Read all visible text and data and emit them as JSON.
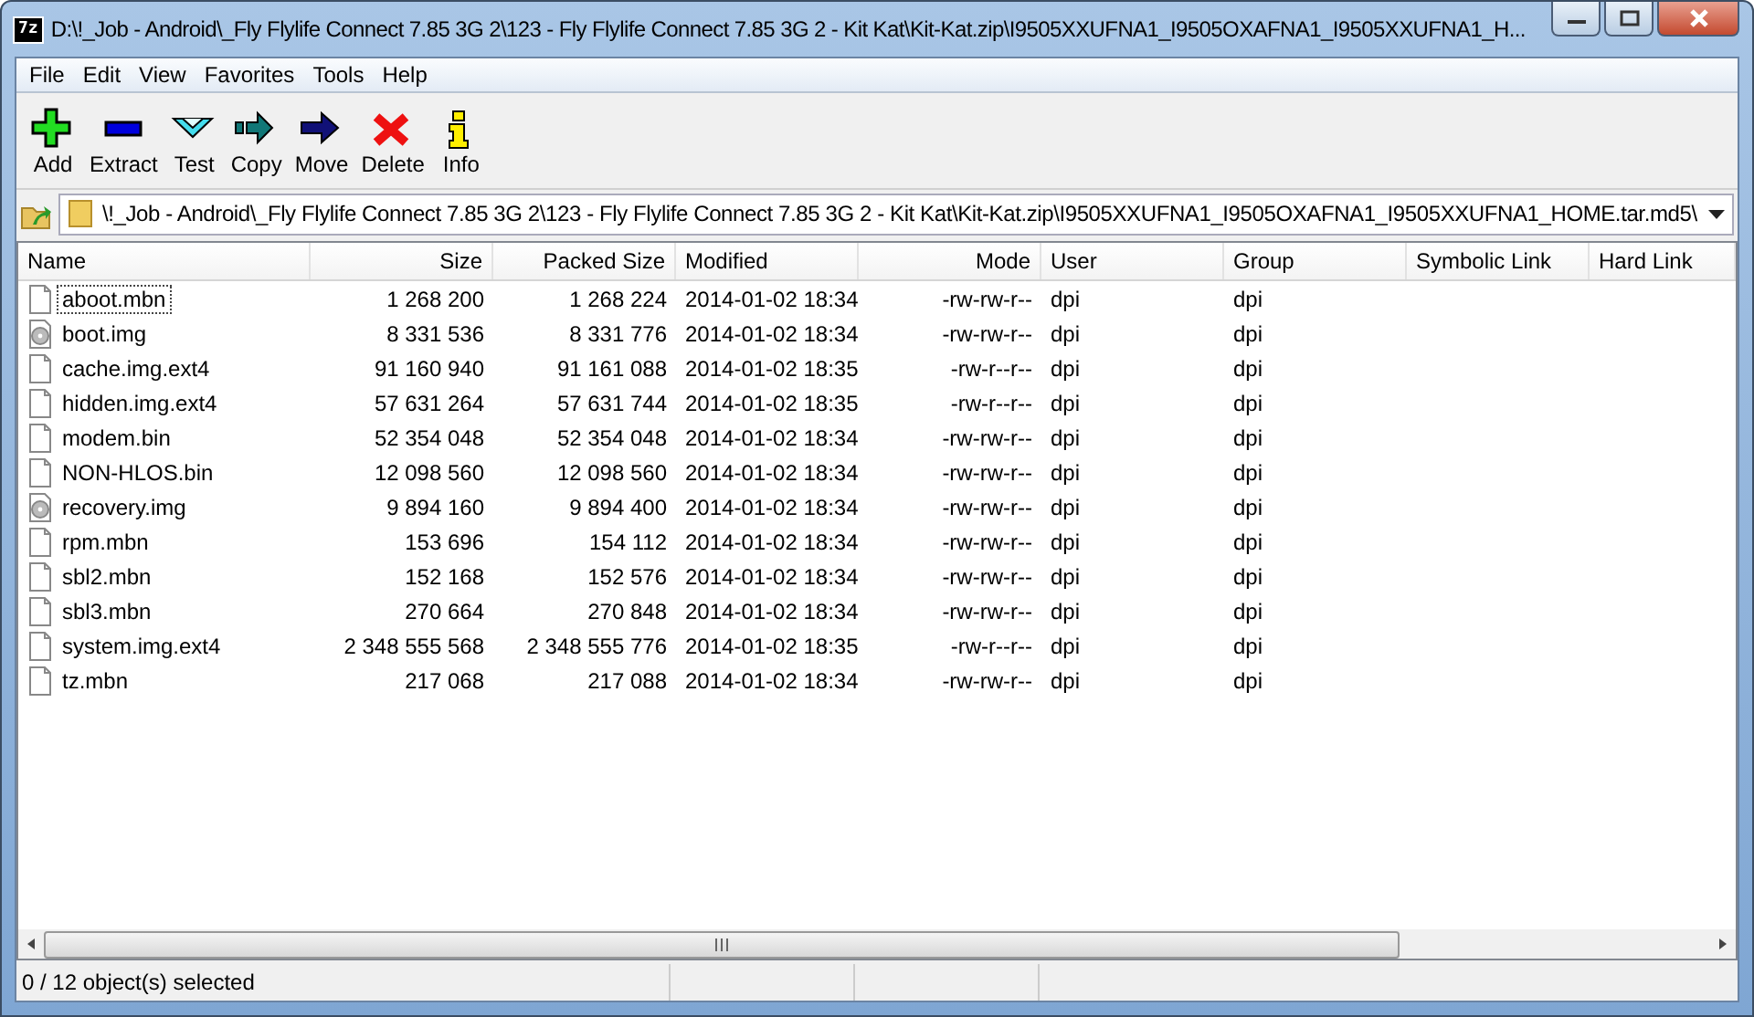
{
  "window": {
    "title": "D:\\!_Job - Android\\_Fly Flylife Connect 7.85 3G 2\\123 - Fly Flylife Connect 7.85 3G 2 - Kit Kat\\Kit-Kat.zip\\I9505XXUFNA1_I9505OXAFNA1_I9505XXUFNA1_H...",
    "app_icon": "7z"
  },
  "menu": [
    "File",
    "Edit",
    "View",
    "Favorites",
    "Tools",
    "Help"
  ],
  "toolbar": [
    {
      "label": "Add",
      "kind": "add"
    },
    {
      "label": "Extract",
      "kind": "extract"
    },
    {
      "label": "Test",
      "kind": "test"
    },
    {
      "label": "Copy",
      "kind": "copy"
    },
    {
      "label": "Move",
      "kind": "move"
    },
    {
      "label": "Delete",
      "kind": "delete"
    },
    {
      "label": "Info",
      "kind": "info"
    }
  ],
  "address": {
    "value": "\\!_Job - Android\\_Fly Flylife Connect 7.85 3G 2\\123 - Fly Flylife Connect 7.85 3G 2 - Kit Kat\\Kit-Kat.zip\\I9505XXUFNA1_I9505OXAFNA1_I9505XXUFNA1_HOME.tar.md5\\"
  },
  "table": {
    "columns": [
      "Name",
      "Size",
      "Packed Size",
      "Modified",
      "Mode",
      "User",
      "Group",
      "Symbolic Link",
      "Hard Link"
    ],
    "rows": [
      {
        "kind": "file",
        "focused": true,
        "cells": [
          "aboot.mbn",
          "1 268 200",
          "1 268 224",
          "2014-01-02 18:34",
          "-rw-rw-r--",
          "dpi",
          "dpi"
        ]
      },
      {
        "kind": "disc",
        "focused": false,
        "cells": [
          "boot.img",
          "8 331 536",
          "8 331 776",
          "2014-01-02 18:34",
          "-rw-rw-r--",
          "dpi",
          "dpi"
        ]
      },
      {
        "kind": "file",
        "focused": false,
        "cells": [
          "cache.img.ext4",
          "91 160 940",
          "91 161 088",
          "2014-01-02 18:35",
          "-rw-r--r--",
          "dpi",
          "dpi"
        ]
      },
      {
        "kind": "file",
        "focused": false,
        "cells": [
          "hidden.img.ext4",
          "57 631 264",
          "57 631 744",
          "2014-01-02 18:35",
          "-rw-r--r--",
          "dpi",
          "dpi"
        ]
      },
      {
        "kind": "file",
        "focused": false,
        "cells": [
          "modem.bin",
          "52 354 048",
          "52 354 048",
          "2014-01-02 18:34",
          "-rw-rw-r--",
          "dpi",
          "dpi"
        ]
      },
      {
        "kind": "file",
        "focused": false,
        "cells": [
          "NON-HLOS.bin",
          "12 098 560",
          "12 098 560",
          "2014-01-02 18:34",
          "-rw-rw-r--",
          "dpi",
          "dpi"
        ]
      },
      {
        "kind": "disc",
        "focused": false,
        "cells": [
          "recovery.img",
          "9 894 160",
          "9 894 400",
          "2014-01-02 18:34",
          "-rw-rw-r--",
          "dpi",
          "dpi"
        ]
      },
      {
        "kind": "file",
        "focused": false,
        "cells": [
          "rpm.mbn",
          "153 696",
          "154 112",
          "2014-01-02 18:34",
          "-rw-rw-r--",
          "dpi",
          "dpi"
        ]
      },
      {
        "kind": "file",
        "focused": false,
        "cells": [
          "sbl2.mbn",
          "152 168",
          "152 576",
          "2014-01-02 18:34",
          "-rw-rw-r--",
          "dpi",
          "dpi"
        ]
      },
      {
        "kind": "file",
        "focused": false,
        "cells": [
          "sbl3.mbn",
          "270 664",
          "270 848",
          "2014-01-02 18:34",
          "-rw-rw-r--",
          "dpi",
          "dpi"
        ]
      },
      {
        "kind": "file",
        "focused": false,
        "cells": [
          "system.img.ext4",
          "2 348 555 568",
          "2 348 555 776",
          "2014-01-02 18:35",
          "-rw-r--r--",
          "dpi",
          "dpi"
        ]
      },
      {
        "kind": "file",
        "focused": false,
        "cells": [
          "tz.mbn",
          "217 068",
          "217 088",
          "2014-01-02 18:34",
          "-rw-rw-r--",
          "dpi",
          "dpi"
        ]
      }
    ]
  },
  "status_bar": "0 / 12 object(s) selected"
}
